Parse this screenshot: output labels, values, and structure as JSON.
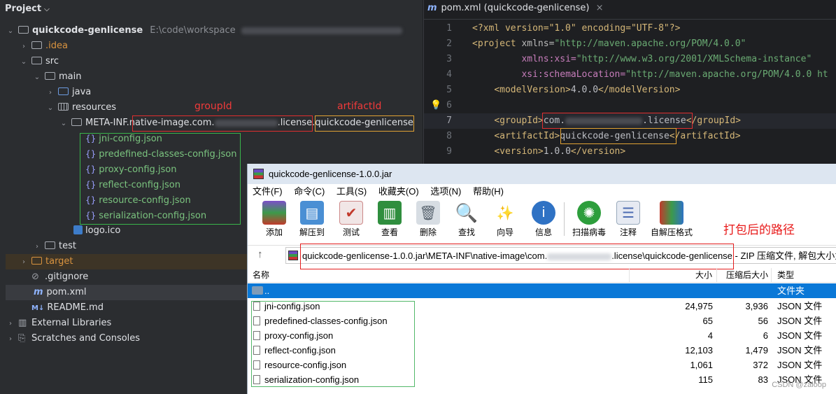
{
  "project": {
    "header": "Project",
    "root_name": "quickcode-genlicense",
    "root_path": "E:\\code\\workspace",
    "items": {
      "idea": ".idea",
      "src": "src",
      "main": "main",
      "java": "java",
      "resources": "resources",
      "meta_inf_prefix": "META-INF.native-image.com.",
      "meta_inf_license": ".license.",
      "meta_inf_artifact": "quickcode-genlicense",
      "json_files": [
        "jni-config.json",
        "predefined-classes-config.json",
        "proxy-config.json",
        "reflect-config.json",
        "resource-config.json",
        "serialization-config.json"
      ],
      "logo": "logo.ico",
      "test": "test",
      "target": "target",
      "gitignore": ".gitignore",
      "pom": "pom.xml",
      "readme": "README.md",
      "external_libraries": "External Libraries",
      "scratches": "Scratches and Consoles"
    },
    "annotations": {
      "groupId": "groupId",
      "artifactId": "artifactId"
    }
  },
  "editor": {
    "tab_label": "pom.xml (quickcode-genlicense)",
    "line_numbers": [
      "1",
      "2",
      "3",
      "4",
      "5",
      "6",
      "7",
      "8",
      "9"
    ],
    "lines": {
      "l1": "<?xml version=\"1.0\" encoding=\"UTF-8\"?>",
      "l2_tag": "<project",
      "l2_attr": " xmlns=",
      "l2_val": "\"http://maven.apache.org/POM/4.0.0\"",
      "l3_attr": "xmlns:xsi=",
      "l3_val": "\"http://www.w3.org/2001/XMLSchema-instance\"",
      "l4_attr": "xsi:schemaLocation=",
      "l4_val": "\"http://maven.apache.org/POM/4.0.0 ht",
      "l5_open": "<modelVersion>",
      "l5_text": "4.0.0",
      "l5_close": "</modelVersion>",
      "l7_open": "<groupId>",
      "l7_text_a": "com.",
      "l7_text_b": ".license",
      "l7_close": "</groupId>",
      "l8_open": "<artifactId>",
      "l8_text": "quickcode-genlicense",
      "l8_close": "</artifactId>",
      "l9_open": "<version>",
      "l9_text": "1.0.0",
      "l9_close": "</version>"
    }
  },
  "rar": {
    "title": "quickcode-genlicense-1.0.0.jar",
    "menu": [
      "文件(F)",
      "命令(C)",
      "工具(S)",
      "收藏夹(O)",
      "选项(N)",
      "帮助(H)"
    ],
    "toolbar": [
      "添加",
      "解压到",
      "测试",
      "查看",
      "删除",
      "查找",
      "向导",
      "信息",
      "扫描病毒",
      "注释",
      "自解压格式"
    ],
    "annotation": "打包后的路径",
    "path_prefix": "quickcode-genlicense-1.0.0.jar\\META-INF\\native-image\\com.",
    "path_suffix": ".license\\quickcode-genlicense",
    "path_tail": " - ZIP 压缩文件, 解包大小为",
    "columns": {
      "name": "名称",
      "size": "大小",
      "packed": "压缩后大小",
      "type": "类型"
    },
    "parent": {
      "name": "..",
      "type": "文件夹"
    },
    "files": [
      {
        "name": "jni-config.json",
        "size": "24,975",
        "packed": "3,936",
        "type": "JSON 文件"
      },
      {
        "name": "predefined-classes-config.json",
        "size": "65",
        "packed": "56",
        "type": "JSON 文件"
      },
      {
        "name": "proxy-config.json",
        "size": "4",
        "packed": "6",
        "type": "JSON 文件"
      },
      {
        "name": "reflect-config.json",
        "size": "12,103",
        "packed": "1,479",
        "type": "JSON 文件"
      },
      {
        "name": "resource-config.json",
        "size": "1,061",
        "packed": "372",
        "type": "JSON 文件"
      },
      {
        "name": "serialization-config.json",
        "size": "115",
        "packed": "83",
        "type": "JSON 文件"
      }
    ],
    "watermark": "CSDN @zaloop"
  }
}
